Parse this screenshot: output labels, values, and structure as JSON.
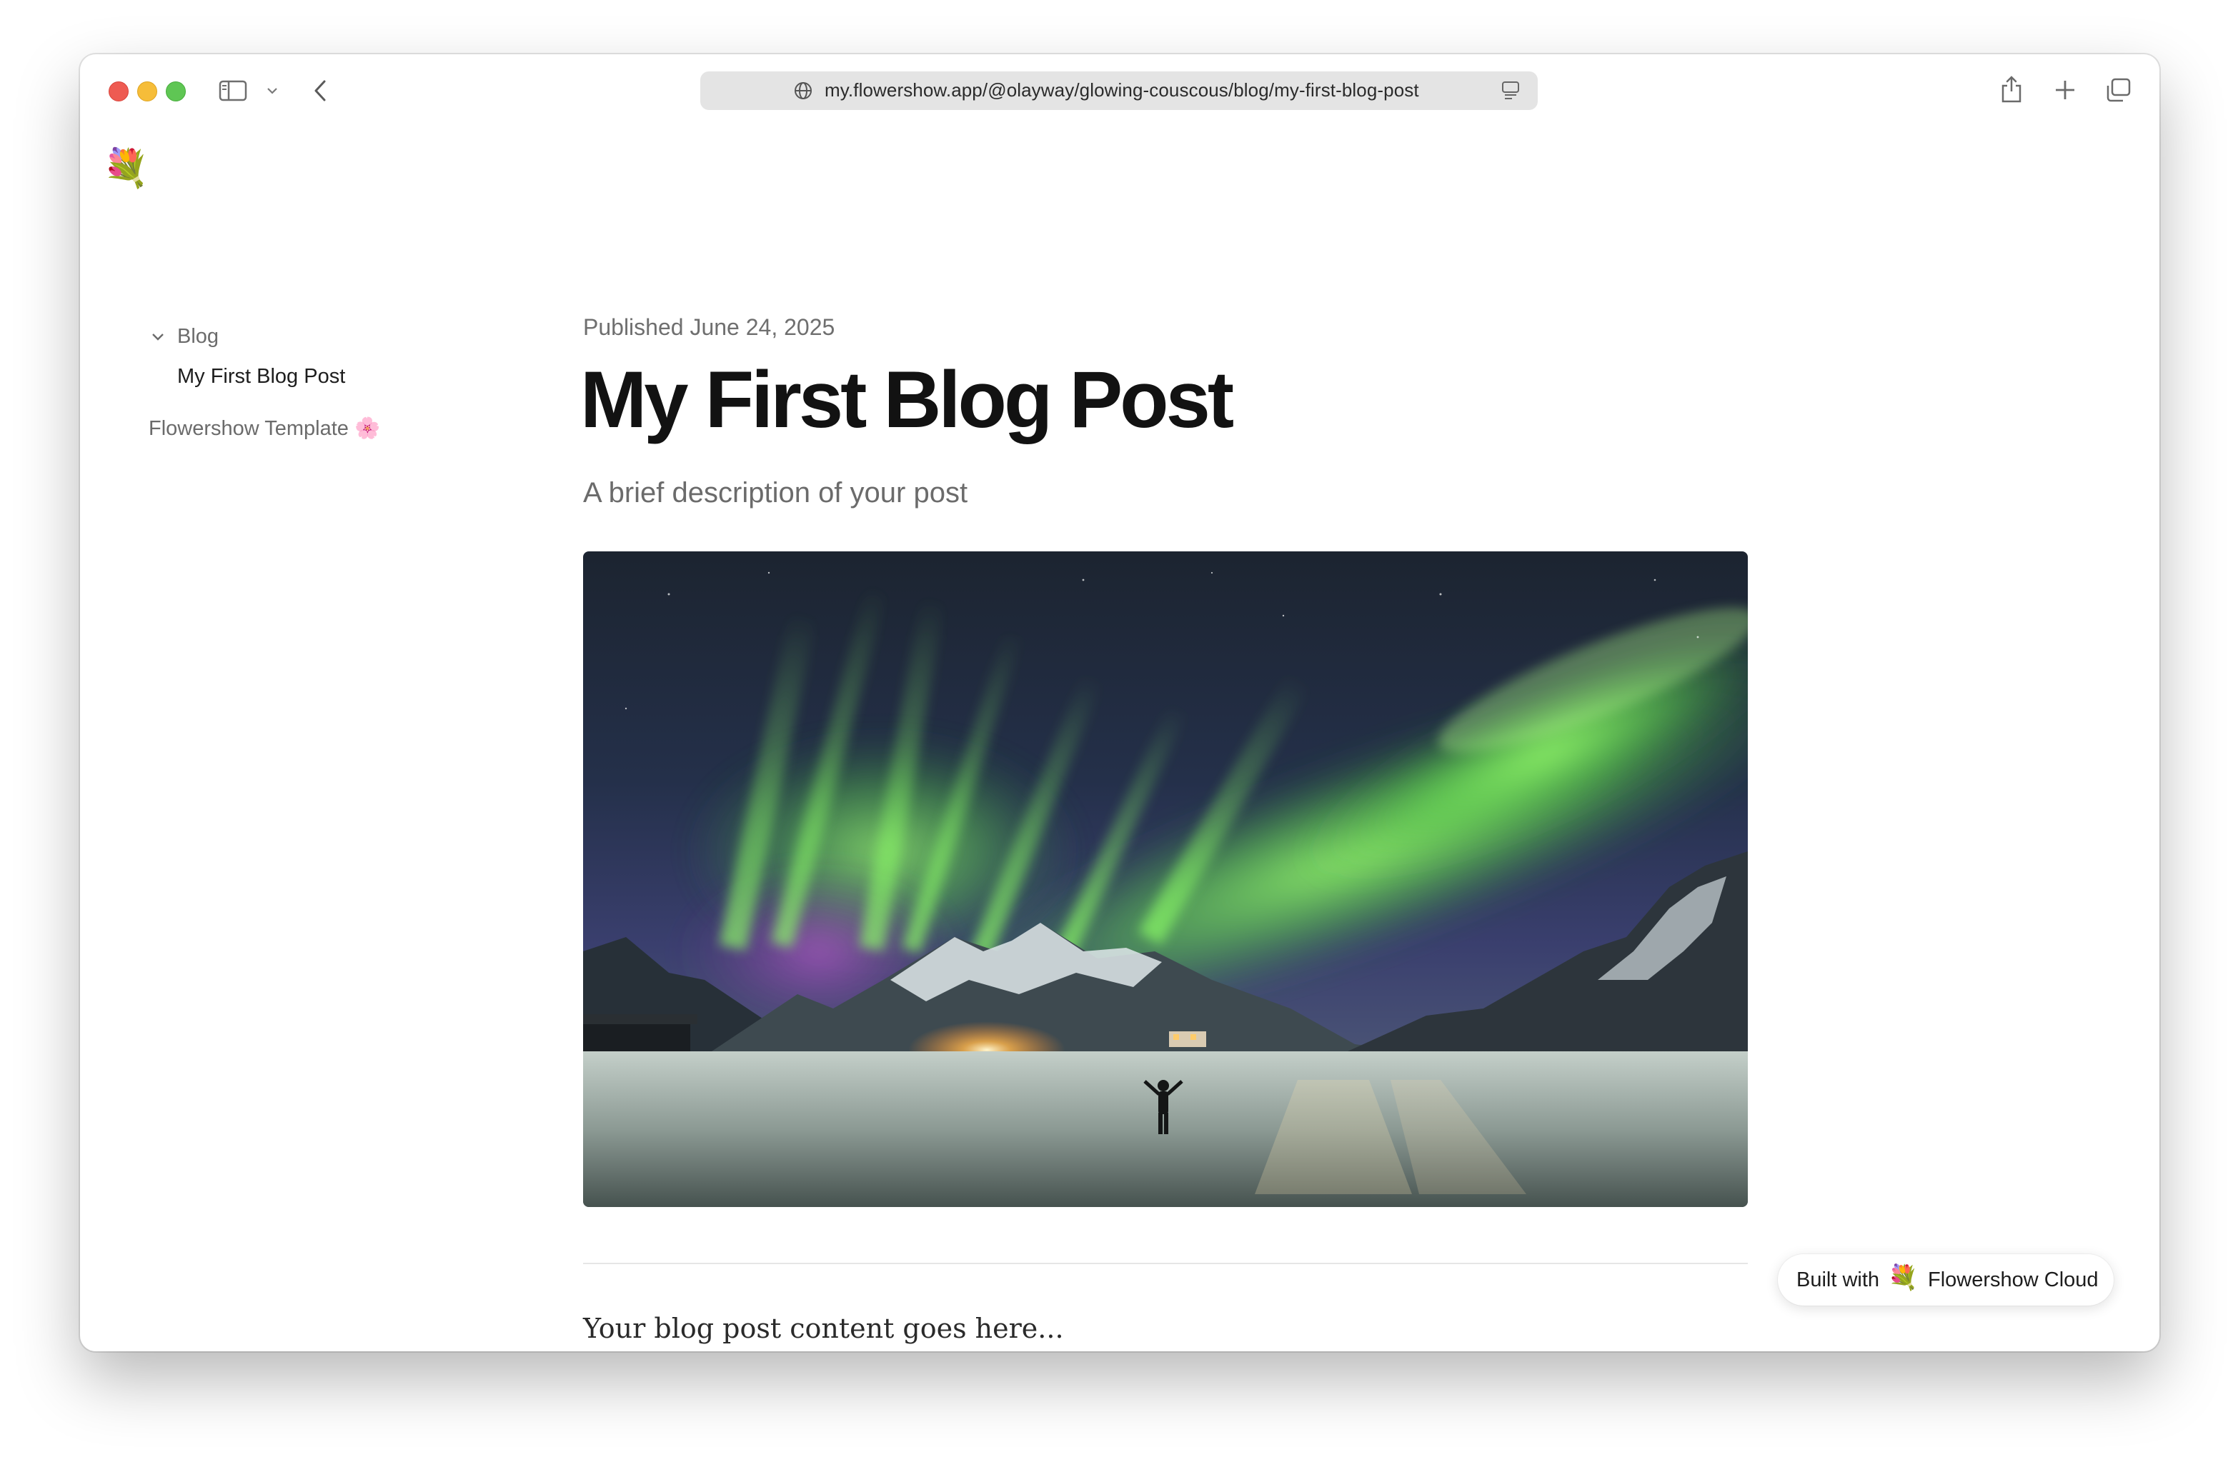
{
  "browser": {
    "url": "my.flowershow.app/@olayway/glowing-couscous/blog/my-first-blog-post",
    "icons": [
      "sidebar-toggle-icon",
      "chevron-down-icon",
      "back-arrow-icon",
      "globe-icon",
      "reader-icon",
      "share-icon",
      "plus-icon",
      "tabs-icon"
    ]
  },
  "site": {
    "logo_emoji": "💐"
  },
  "sidebar": {
    "group_label": "Blog",
    "group_items": [
      "My First Blog Post"
    ],
    "template_label": "Flowershow Template",
    "template_emoji": "🌸"
  },
  "post": {
    "published": "Published June 24, 2025",
    "title": "My First Blog Post",
    "description": "A brief description of your post",
    "hero_alt": "Aurora borealis over snowy mountains with a person standing in the foreground",
    "body": "Your blog post content goes here..."
  },
  "badge": {
    "prefix": "Built with",
    "logo_emoji": "💐",
    "name": "Flowershow Cloud"
  },
  "colors": {
    "close": "#ee5b52",
    "minimize": "#f6bd39",
    "zoom": "#5fc654",
    "aurora": "#7cf25a"
  }
}
